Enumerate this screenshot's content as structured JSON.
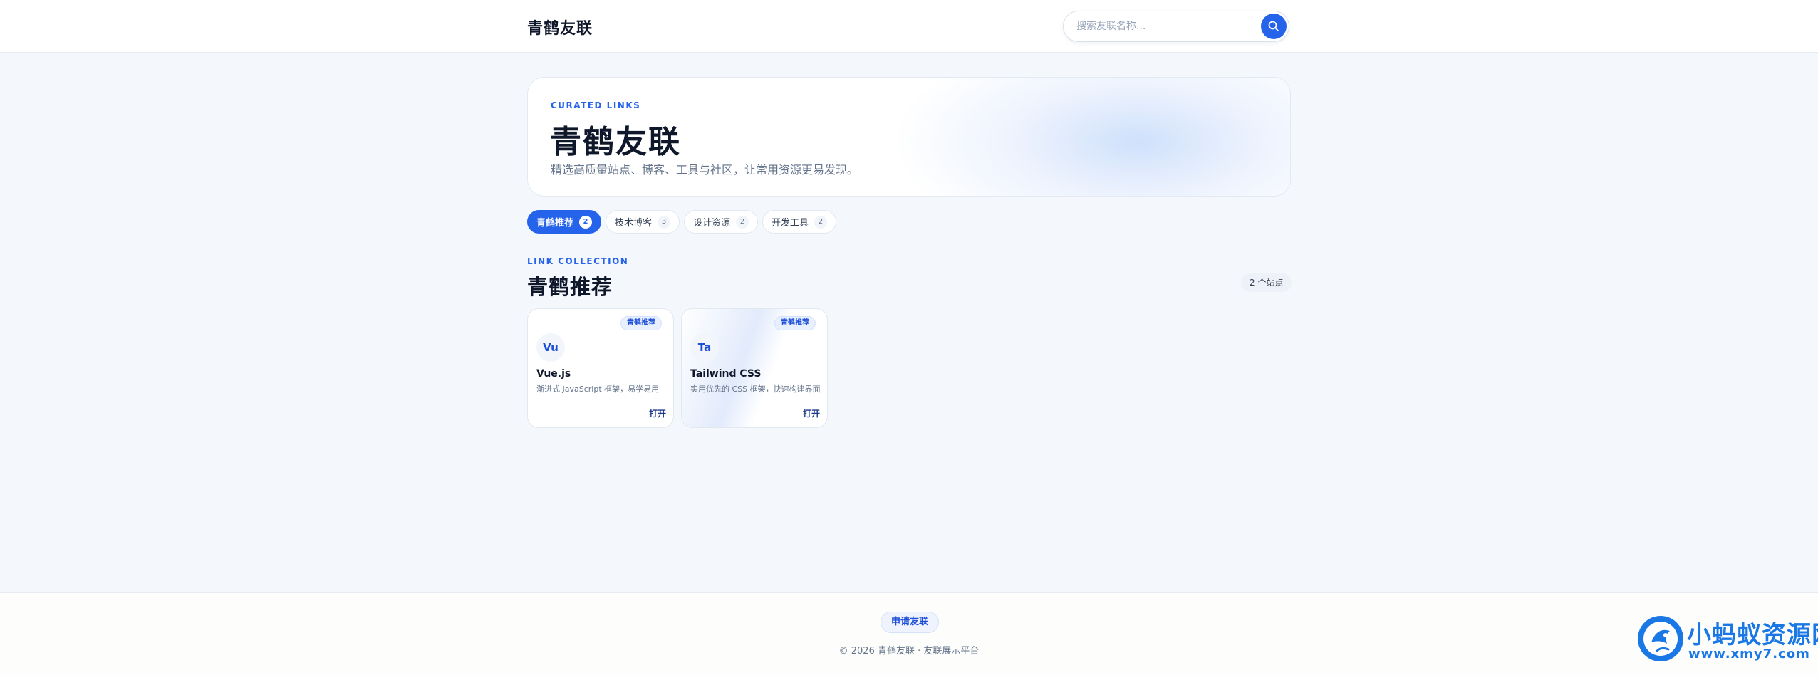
{
  "header": {
    "brand": "青鹤友联",
    "search_placeholder": "搜索友联名称..."
  },
  "hero": {
    "eyebrow": "CURATED LINKS",
    "title": "青鹤友联",
    "subtitle": "精选高质量站点、博客、工具与社区，让常用资源更易发现。"
  },
  "tabs": [
    {
      "label": "青鹤推荐",
      "count": "2",
      "active": true
    },
    {
      "label": "技术博客",
      "count": "3",
      "active": false
    },
    {
      "label": "设计资源",
      "count": "2",
      "active": false
    },
    {
      "label": "开发工具",
      "count": "2",
      "active": false
    }
  ],
  "section": {
    "eyebrow": "LINK COLLECTION",
    "title": "青鹤推荐",
    "count_label": "2 个站点"
  },
  "cards": [
    {
      "tag": "青鹤推荐",
      "logo": "Vu",
      "name": "Vue.js",
      "desc": "渐进式 JavaScript 框架，易学易用",
      "action": "打开"
    },
    {
      "tag": "青鹤推荐",
      "logo": "Ta",
      "name": "Tailwind CSS",
      "desc": "实用优先的 CSS 框架，快速构建界面",
      "action": "打开"
    }
  ],
  "footer": {
    "apply_label": "申请友联",
    "copyright": "© 2026 青鹤友联 · 友联展示平台"
  },
  "watermark": {
    "name": "小蚂蚁资源网",
    "url": "www.xmy7.com"
  },
  "colors": {
    "accent": "#2563eb",
    "page_bg": "#f4f7fc",
    "watermark": "#1a78e6"
  },
  "icons": {
    "search": "search-icon"
  }
}
